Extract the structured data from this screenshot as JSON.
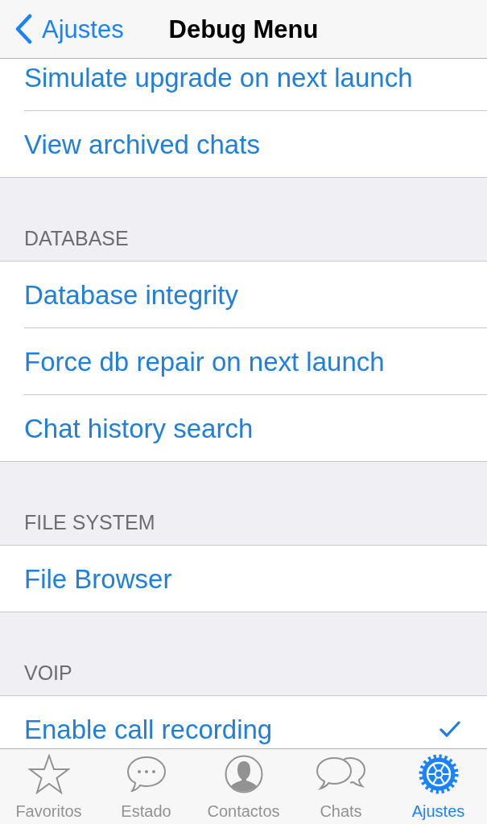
{
  "nav_bar": {
    "back": "Ajustes",
    "title": "Debug Menu"
  },
  "sections": [
    {
      "rows": [
        {
          "label": "Simulate upgrade on next launch"
        },
        {
          "label": "View archived chats"
        }
      ]
    },
    {
      "header": "DATABASE",
      "rows": [
        {
          "label": "Database integrity"
        },
        {
          "label": "Force db repair on next launch"
        },
        {
          "label": "Chat history search"
        }
      ]
    },
    {
      "header": "FILE SYSTEM",
      "rows": [
        {
          "label": "File Browser"
        }
      ]
    },
    {
      "header": "VOIP",
      "rows": [
        {
          "label": "Enable call recording",
          "checked": true
        }
      ]
    }
  ],
  "tab_bar": [
    {
      "label": "Favoritos",
      "selected": false
    },
    {
      "label": "Estado",
      "selected": false
    },
    {
      "label": "Contactos",
      "selected": false
    },
    {
      "label": "Chats",
      "selected": false
    },
    {
      "label": "Ajustes",
      "selected": true
    }
  ]
}
